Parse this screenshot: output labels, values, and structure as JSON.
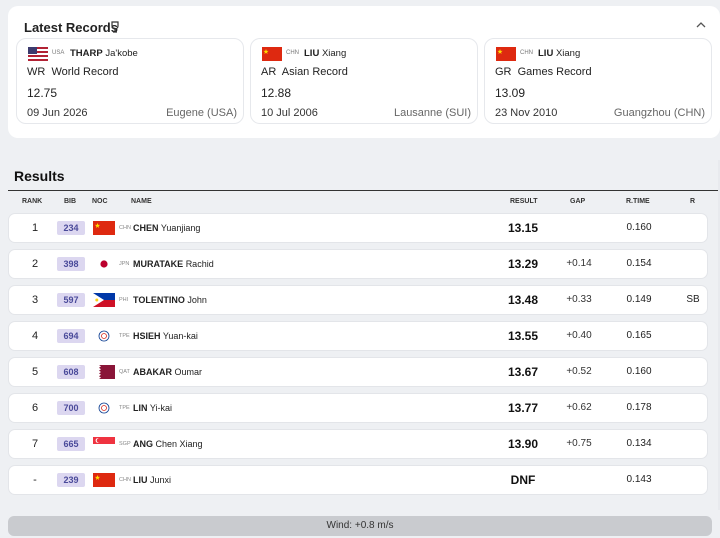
{
  "latest_records": {
    "title": "Latest Records",
    "icon": "trophy-icon",
    "collapse_icon": "chevron-up-icon",
    "cards": [
      {
        "flag": "usa-flag",
        "noc": "USA",
        "surname": "THARP",
        "given": "Ja'kobe",
        "type": "WR  World Record",
        "value": "12.75",
        "date": "09 Jun 2026",
        "venue": "Eugene (USA)"
      },
      {
        "flag": "chn-flag",
        "noc": "CHN",
        "surname": "LIU",
        "given": "Xiang",
        "type": "AR  Asian Record",
        "value": "12.88",
        "date": "10 Jul 2006",
        "venue": "Lausanne (SUI)"
      },
      {
        "flag": "chn-flag",
        "noc": "CHN",
        "surname": "LIU",
        "given": "Xiang",
        "type": "GR  Games Record",
        "value": "13.09",
        "date": "23 Nov 2010",
        "venue": "Guangzhou (CHN)"
      }
    ]
  },
  "results": {
    "title": "Results",
    "headers": {
      "rank": "RANK",
      "bib": "BIB",
      "noc": "NOC",
      "name": "NAME",
      "result": "RESULT",
      "gap": "GAP",
      "rtime": "R.TIME",
      "note": "R"
    },
    "rows": [
      {
        "rank": "1",
        "bib": "234",
        "noc": "CHN",
        "flag": "chn-flag",
        "surname": "CHEN",
        "given": "Yuanjiang",
        "result": "13.15",
        "gap": "",
        "rtime": "0.160",
        "note": ""
      },
      {
        "rank": "2",
        "bib": "398",
        "noc": "JPN",
        "flag": "jpn-flag",
        "surname": "MURATAKE",
        "given": "Rachid",
        "result": "13.29",
        "gap": "+0.14",
        "rtime": "0.154",
        "note": ""
      },
      {
        "rank": "3",
        "bib": "597",
        "noc": "PHI",
        "flag": "phi-flag",
        "surname": "TOLENTINO",
        "given": "John",
        "result": "13.48",
        "gap": "+0.33",
        "rtime": "0.149",
        "note": "SB"
      },
      {
        "rank": "4",
        "bib": "694",
        "noc": "TPE",
        "flag": "tpe-flag",
        "surname": "HSIEH",
        "given": "Yuan-kai",
        "result": "13.55",
        "gap": "+0.40",
        "rtime": "0.165",
        "note": ""
      },
      {
        "rank": "5",
        "bib": "608",
        "noc": "QAT",
        "flag": "qat-flag",
        "surname": "ABAKAR",
        "given": "Oumar",
        "result": "13.67",
        "gap": "+0.52",
        "rtime": "0.160",
        "note": ""
      },
      {
        "rank": "6",
        "bib": "700",
        "noc": "TPE",
        "flag": "tpe-flag",
        "surname": "LIN",
        "given": "Yi-kai",
        "result": "13.77",
        "gap": "+0.62",
        "rtime": "0.178",
        "note": ""
      },
      {
        "rank": "7",
        "bib": "665",
        "noc": "SGP",
        "flag": "sgp-flag",
        "surname": "ANG",
        "given": "Chen Xiang",
        "result": "13.90",
        "gap": "+0.75",
        "rtime": "0.134",
        "note": ""
      },
      {
        "rank": "-",
        "bib": "239",
        "noc": "CHN",
        "flag": "chn-flag",
        "surname": "LIU",
        "given": "Junxi",
        "result": "DNF",
        "gap": "",
        "rtime": "0.143",
        "note": ""
      }
    ]
  },
  "wind": {
    "label": "Wind: +0.8 m/s"
  },
  "colors": {
    "bib_bg": "#dcd7f0",
    "bib_text": "#4a4a9a",
    "chn_red": "#de2910",
    "star_yellow": "#ffde00"
  }
}
